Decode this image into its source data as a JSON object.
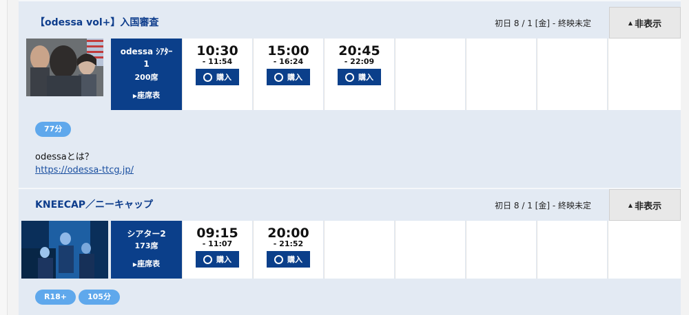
{
  "films": [
    {
      "title": "【odessa vol+】入国審査",
      "period": "初日 8 / 1 [金] - 終映未定",
      "hide_label": "非表示",
      "theater": {
        "name": "odessa ｼｱﾀｰ1",
        "seats": "200席",
        "seatmap_label": "座席表"
      },
      "showtimes": [
        {
          "start": "10:30",
          "end": "- 11:54",
          "buy_label": "購入"
        },
        {
          "start": "15:00",
          "end": "- 16:24",
          "buy_label": "購入"
        },
        {
          "start": "20:45",
          "end": "- 22:09",
          "buy_label": "購入"
        }
      ],
      "tags": [
        "77分"
      ],
      "description": "odessaとは？",
      "link": "https://odessa-ttcg.jp/"
    },
    {
      "title": "KNEECAP／ニーキャップ",
      "period": "初日 8 / 1 [金] - 終映未定",
      "hide_label": "非表示",
      "theater": {
        "name": "シアター2",
        "seats": "173席",
        "seatmap_label": "座席表"
      },
      "showtimes": [
        {
          "start": "09:15",
          "end": "- 11:07",
          "buy_label": "購入"
        },
        {
          "start": "20:00",
          "end": "- 21:52",
          "buy_label": "購入"
        }
      ],
      "tags": [
        "R18+",
        "105分"
      ]
    }
  ],
  "colors": {
    "brand_navy": "#0b3f8a",
    "tag_blue": "#5fa8ec",
    "header_bg": "#e3eaf3",
    "title_blue": "#0e3d8c"
  }
}
